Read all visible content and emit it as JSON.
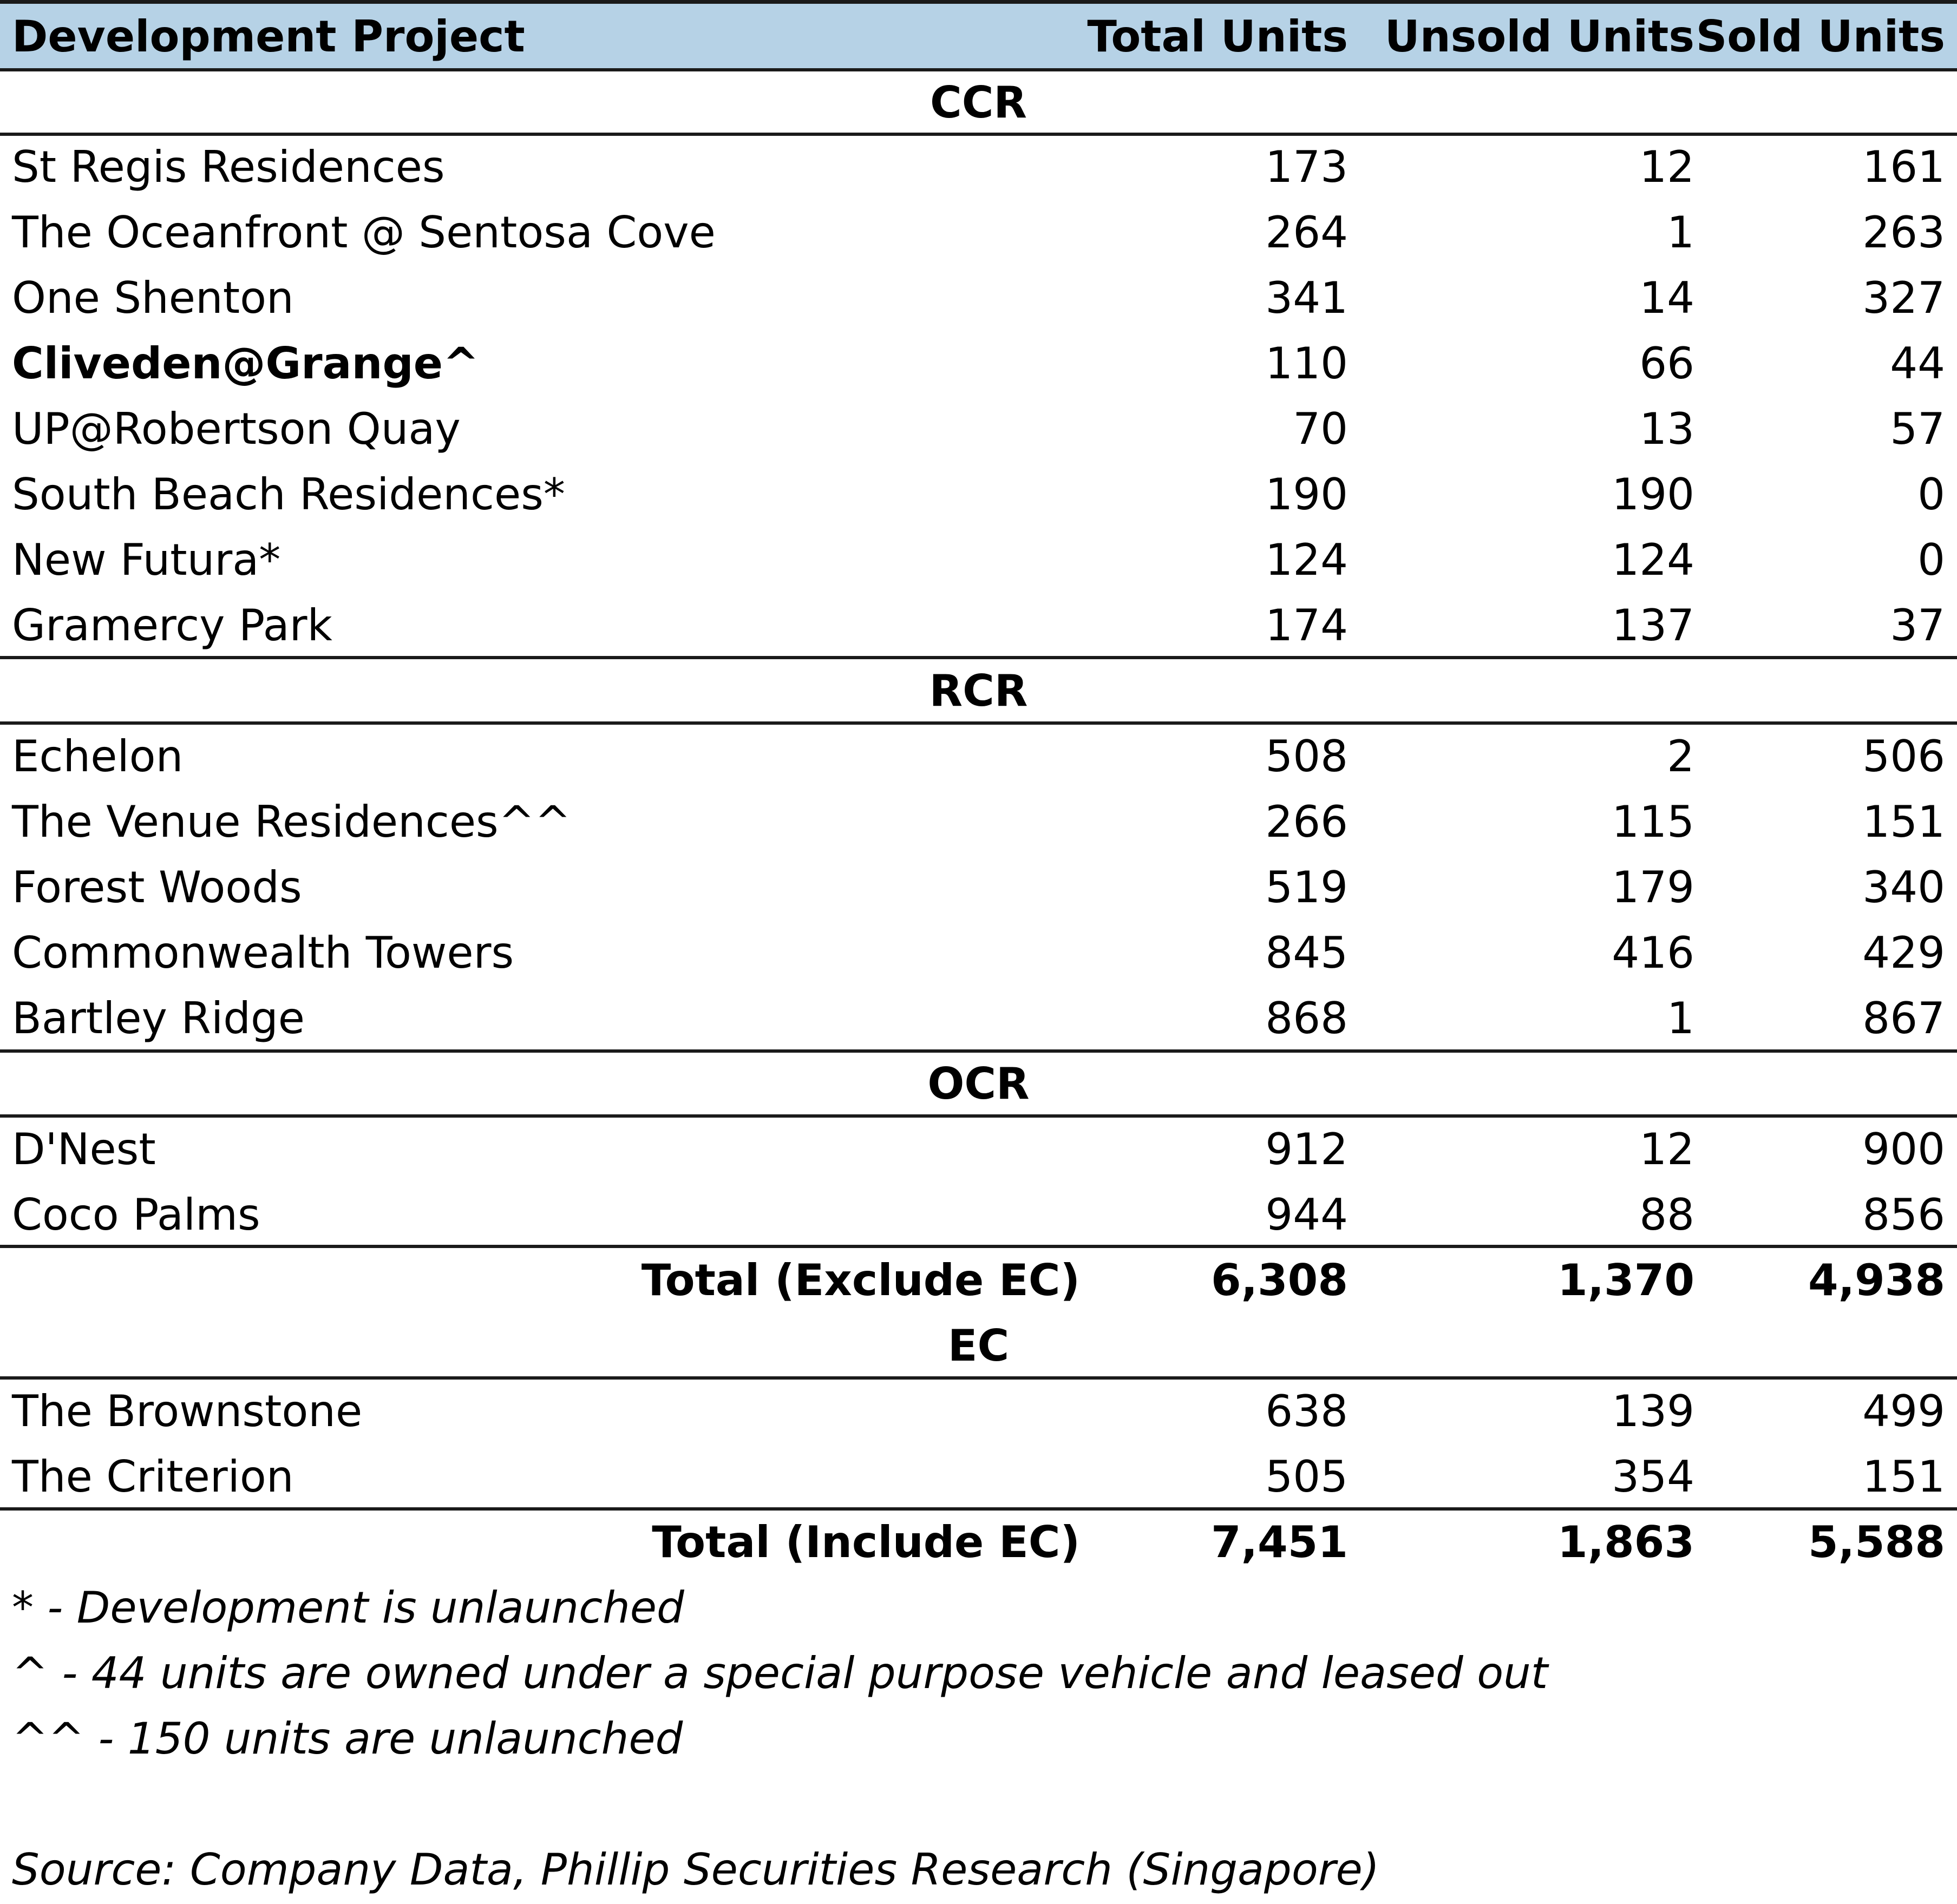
{
  "chart_data": {
    "type": "table",
    "columns": [
      "Development Project",
      "Total Units",
      "Unsold Units",
      "Sold Units"
    ],
    "sections": [
      {
        "name": "CCR",
        "rows": [
          {
            "project": "St Regis Residences",
            "total": "173",
            "unsold": "12",
            "sold": "161"
          },
          {
            "project": "The Oceanfront @ Sentosa Cove",
            "total": "264",
            "unsold": "1",
            "sold": "263"
          },
          {
            "project": "One Shenton",
            "total": "341",
            "unsold": "14",
            "sold": "327"
          },
          {
            "project": "Cliveden@Grange^",
            "total": "110",
            "unsold": "66",
            "sold": "44"
          },
          {
            "project": "UP@Robertson Quay",
            "total": "70",
            "unsold": "13",
            "sold": "57"
          },
          {
            "project": "South Beach Residences*",
            "total": "190",
            "unsold": "190",
            "sold": "0"
          },
          {
            "project": "New Futura*",
            "total": "124",
            "unsold": "124",
            "sold": "0"
          },
          {
            "project": "Gramercy Park",
            "total": "174",
            "unsold": "137",
            "sold": "37"
          }
        ]
      },
      {
        "name": "RCR",
        "rows": [
          {
            "project": "Echelon",
            "total": "508",
            "unsold": "2",
            "sold": "506"
          },
          {
            "project": "The Venue Residences^^",
            "total": "266",
            "unsold": "115",
            "sold": "151"
          },
          {
            "project": "Forest Woods",
            "total": "519",
            "unsold": "179",
            "sold": "340"
          },
          {
            "project": "Commonwealth Towers",
            "total": "845",
            "unsold": "416",
            "sold": "429"
          },
          {
            "project": "Bartley Ridge",
            "total": "868",
            "unsold": "1",
            "sold": "867"
          }
        ]
      },
      {
        "name": "OCR",
        "rows": [
          {
            "project": "D'Nest",
            "total": "912",
            "unsold": "12",
            "sold": "900"
          },
          {
            "project": "Coco Palms",
            "total": "944",
            "unsold": "88",
            "sold": "856"
          }
        ]
      },
      {
        "name": "EC",
        "rows": [
          {
            "project": "The Brownstone",
            "total": "638",
            "unsold": "139",
            "sold": "499"
          },
          {
            "project": "The Criterion",
            "total": "505",
            "unsold": "354",
            "sold": "151"
          }
        ]
      }
    ],
    "totals": {
      "exclude_ec": {
        "label": "Total (Exclude EC)",
        "total": "6,308",
        "unsold": "1,370",
        "sold": "4,938"
      },
      "include_ec": {
        "label": "Total (Include EC)",
        "total": "7,451",
        "unsold": "1,863",
        "sold": "5,588"
      }
    },
    "footnotes": [
      "* - Development is unlaunched",
      "^ - 44 units are owned under a special purpose vehicle and leased out",
      "^^ - 150 units are unlaunched"
    ],
    "source": "Source: Company Data, Phillip Securities Research (Singapore)"
  },
  "colors": {
    "header_fill": "#b6d2e6",
    "rule": "#1a1a1a"
  }
}
